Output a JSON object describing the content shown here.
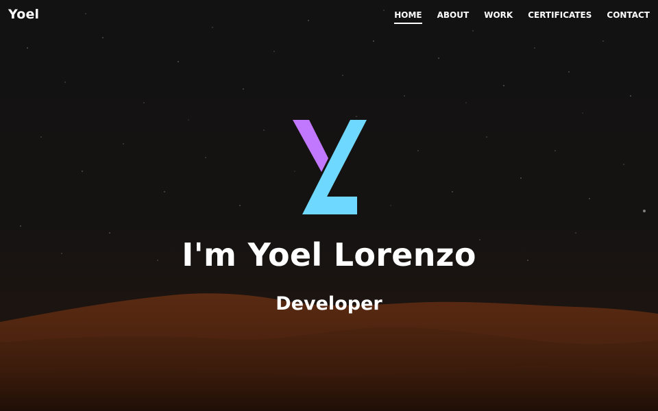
{
  "nav": {
    "brand": "Yoel",
    "items": [
      {
        "label": "HOME",
        "active": true
      },
      {
        "label": "ABOUT",
        "active": false
      },
      {
        "label": "WORK",
        "active": false
      },
      {
        "label": "CERTIFICATES",
        "active": false
      },
      {
        "label": "CONTACT",
        "active": false
      }
    ]
  },
  "hero": {
    "headline": "I'm Yoel Lorenzo",
    "role": "Developer",
    "logo_colors": {
      "left_stroke": "#c277ff",
      "right_stroke": "#6fd8ff"
    }
  },
  "theme": {
    "sky": "#141414",
    "dune": "#5a2a10",
    "text": "#ffffff"
  }
}
